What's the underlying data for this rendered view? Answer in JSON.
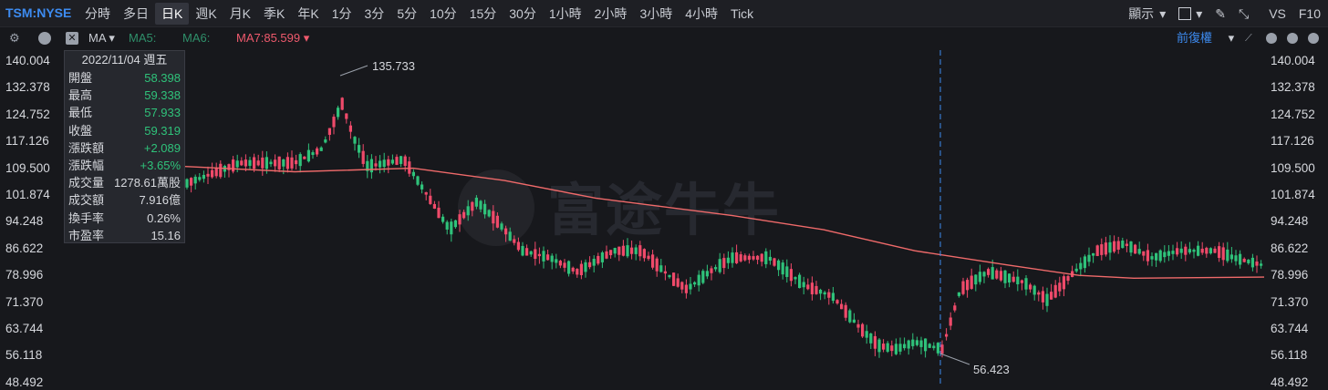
{
  "topbar": {
    "symbol": "TSM:NYSE",
    "timeframes": [
      "分時",
      "多日",
      "日K",
      "週K",
      "月K",
      "季K",
      "年K",
      "1分",
      "3分",
      "5分",
      "10分",
      "15分",
      "30分",
      "1小時",
      "2小時",
      "3小時",
      "4小時",
      "Tick"
    ],
    "active_timeframe": "日K",
    "display_label": "顯示",
    "vs_label": "VS",
    "f10_label": "F10"
  },
  "indicator_bar": {
    "ma_label": "MA",
    "ma5_label": "MA5:",
    "ma6_label": "MA6:",
    "ma7_label": "MA7:85.599",
    "adjust_label": "前復權",
    "icons": [
      "gear-icon",
      "up-circle-icon",
      "close-box-icon",
      "pencil-icon",
      "collapse-icon",
      "minus-circle-icon",
      "plus-circle-icon"
    ]
  },
  "y_axis": [
    "140.004",
    "132.378",
    "124.752",
    "117.126",
    "109.500",
    "101.874",
    "94.248",
    "86.622",
    "78.996",
    "71.370",
    "63.744",
    "56.118",
    "48.492"
  ],
  "info": {
    "date": "2022/11/04 週五",
    "rows": [
      {
        "k": "開盤",
        "v": "58.398",
        "green": true
      },
      {
        "k": "最高",
        "v": "59.338",
        "green": true
      },
      {
        "k": "最低",
        "v": "57.933",
        "green": true
      },
      {
        "k": "收盤",
        "v": "59.319",
        "green": true
      },
      {
        "k": "漲跌額",
        "v": "+2.089",
        "green": true
      },
      {
        "k": "漲跌幅",
        "v": "+3.65%",
        "green": true
      },
      {
        "k": "成交量",
        "v": "1278.61萬股",
        "green": false
      },
      {
        "k": "成交額",
        "v": "7.916億",
        "green": false
      },
      {
        "k": "換手率",
        "v": "0.26%",
        "green": false
      },
      {
        "k": "市盈率",
        "v": "15.16",
        "green": false
      }
    ]
  },
  "annotations": {
    "high": "135.733",
    "low": "56.423"
  },
  "watermark": "富途牛牛",
  "colors": {
    "up": "#2fc27a",
    "down": "#ef4a6a",
    "ma": "#ef6a6a",
    "accent": "#3d8bf0",
    "cursor": "#3d8bf0"
  }
}
